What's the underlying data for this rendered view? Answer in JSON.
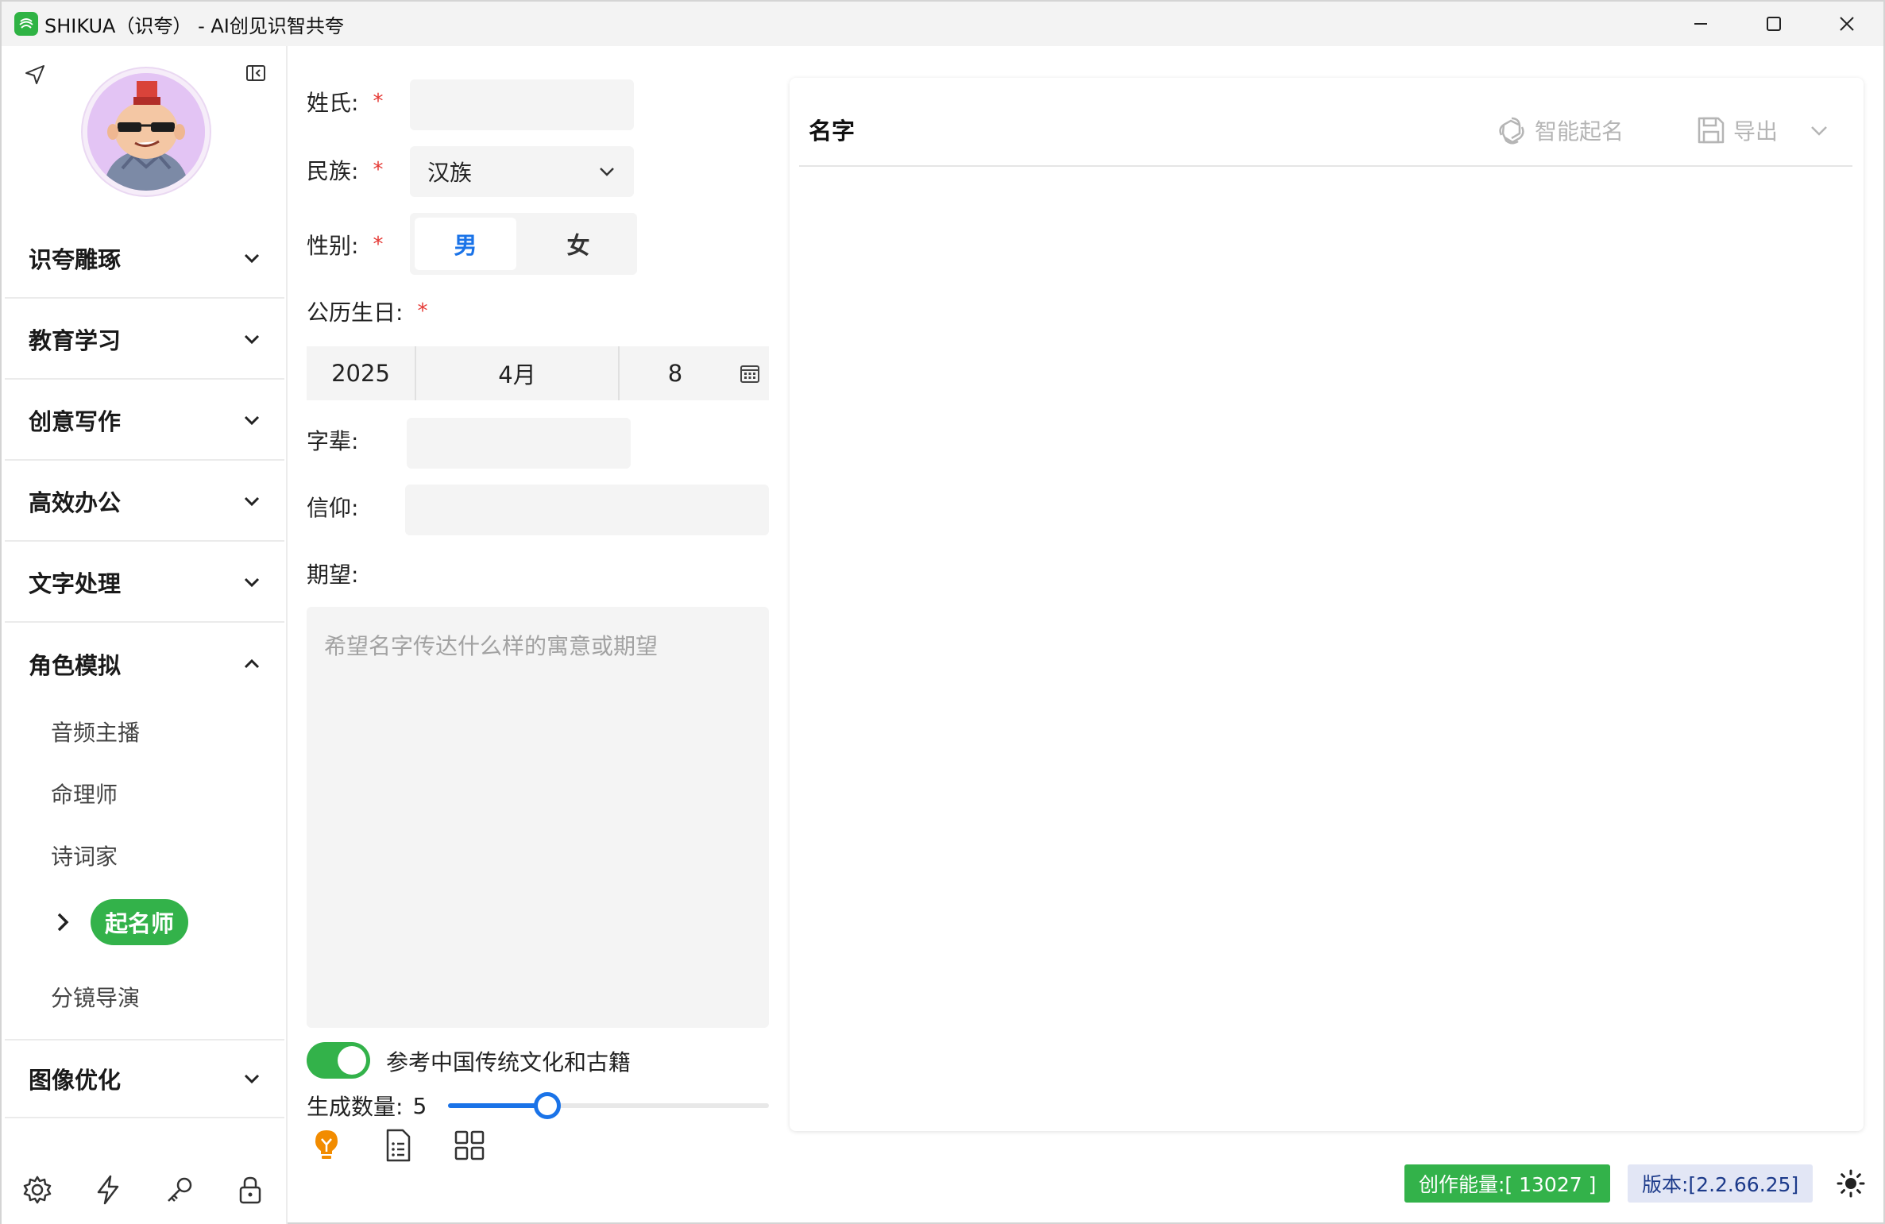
{
  "window": {
    "title": "SHIKUA（识夸） - AI创见识智共夸",
    "controls": [
      "minimize",
      "maximize",
      "close"
    ]
  },
  "sidebar": {
    "sections": [
      {
        "label": "识夸雕琢",
        "expanded": false
      },
      {
        "label": "教育学习",
        "expanded": false
      },
      {
        "label": "创意写作",
        "expanded": false
      },
      {
        "label": "高效办公",
        "expanded": false
      },
      {
        "label": "文字处理",
        "expanded": false
      },
      {
        "label": "角色模拟",
        "expanded": true
      },
      {
        "label": "图像优化",
        "expanded": false
      }
    ],
    "sub_items": [
      "音频主播",
      "命理师",
      "诗词家",
      "起名师",
      "分镜导演"
    ],
    "active_item": "起名师",
    "bottom_icons": [
      "gear-icon",
      "bolt-icon",
      "key-icon",
      "lock-icon"
    ]
  },
  "form": {
    "surname_label": "姓氏:",
    "surname_value": "",
    "ethnicity_label": "民族:",
    "ethnicity_value": "汉族",
    "gender_label": "性别:",
    "gender_options": [
      "男",
      "女"
    ],
    "gender_selected": "男",
    "birthday_label": "公历生日:",
    "birth_year": "2025",
    "birth_month": "4月",
    "birth_day": "8",
    "generation_label": "字辈:",
    "generation_value": "",
    "faith_label": "信仰:",
    "faith_value": "",
    "expectation_label": "期望:",
    "expectation_placeholder": "希望名字传达什么样的寓意或期望",
    "reference_toggle_label": "参考中国传统文化和古籍",
    "reference_toggle_on": true,
    "count_label": "生成数量:",
    "count_value": "5",
    "count_fraction": 0.31,
    "required_mark": "*",
    "bottom_icons": [
      "lightbulb-icon",
      "document-list-icon",
      "grid-icon"
    ]
  },
  "result": {
    "title": "名字",
    "generate_label": "智能起名",
    "export_label": "导出"
  },
  "status": {
    "energy": "创作能量:[ 13027 ]",
    "version": "版本:[2.2.66.25]"
  },
  "colors": {
    "accent_green": "#33b24a",
    "accent_blue": "#1a73e8",
    "required_red": "#e53935"
  }
}
